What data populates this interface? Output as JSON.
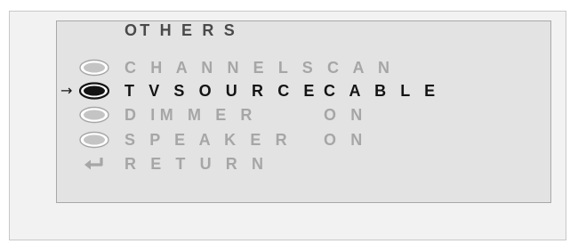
{
  "menu": {
    "title": "OT H E R S",
    "selector_arrow": "→",
    "items": [
      {
        "label": "C H A N N E L S C A N",
        "value": "",
        "icon": "oval-icon",
        "state": "muted",
        "selected": false
      },
      {
        "label": "T V S O U R C E",
        "value": "C A B L E",
        "icon": "oval-icon",
        "state": "active",
        "selected": true
      },
      {
        "label": "D IM M E R",
        "value": "O N",
        "icon": "oval-icon",
        "state": "muted",
        "selected": false
      },
      {
        "label": "S P E A K E R",
        "value": "O N",
        "icon": "oval-icon",
        "state": "muted",
        "selected": false
      },
      {
        "label": "R E T U R N",
        "value": "",
        "icon": "return-arrow-icon",
        "state": "muted",
        "selected": false
      }
    ]
  },
  "colors": {
    "panel_background": "#e3e3e3",
    "muted_text": "#a6a6a6",
    "active_text": "#141414",
    "icon_fill": "#c4c4c4"
  }
}
